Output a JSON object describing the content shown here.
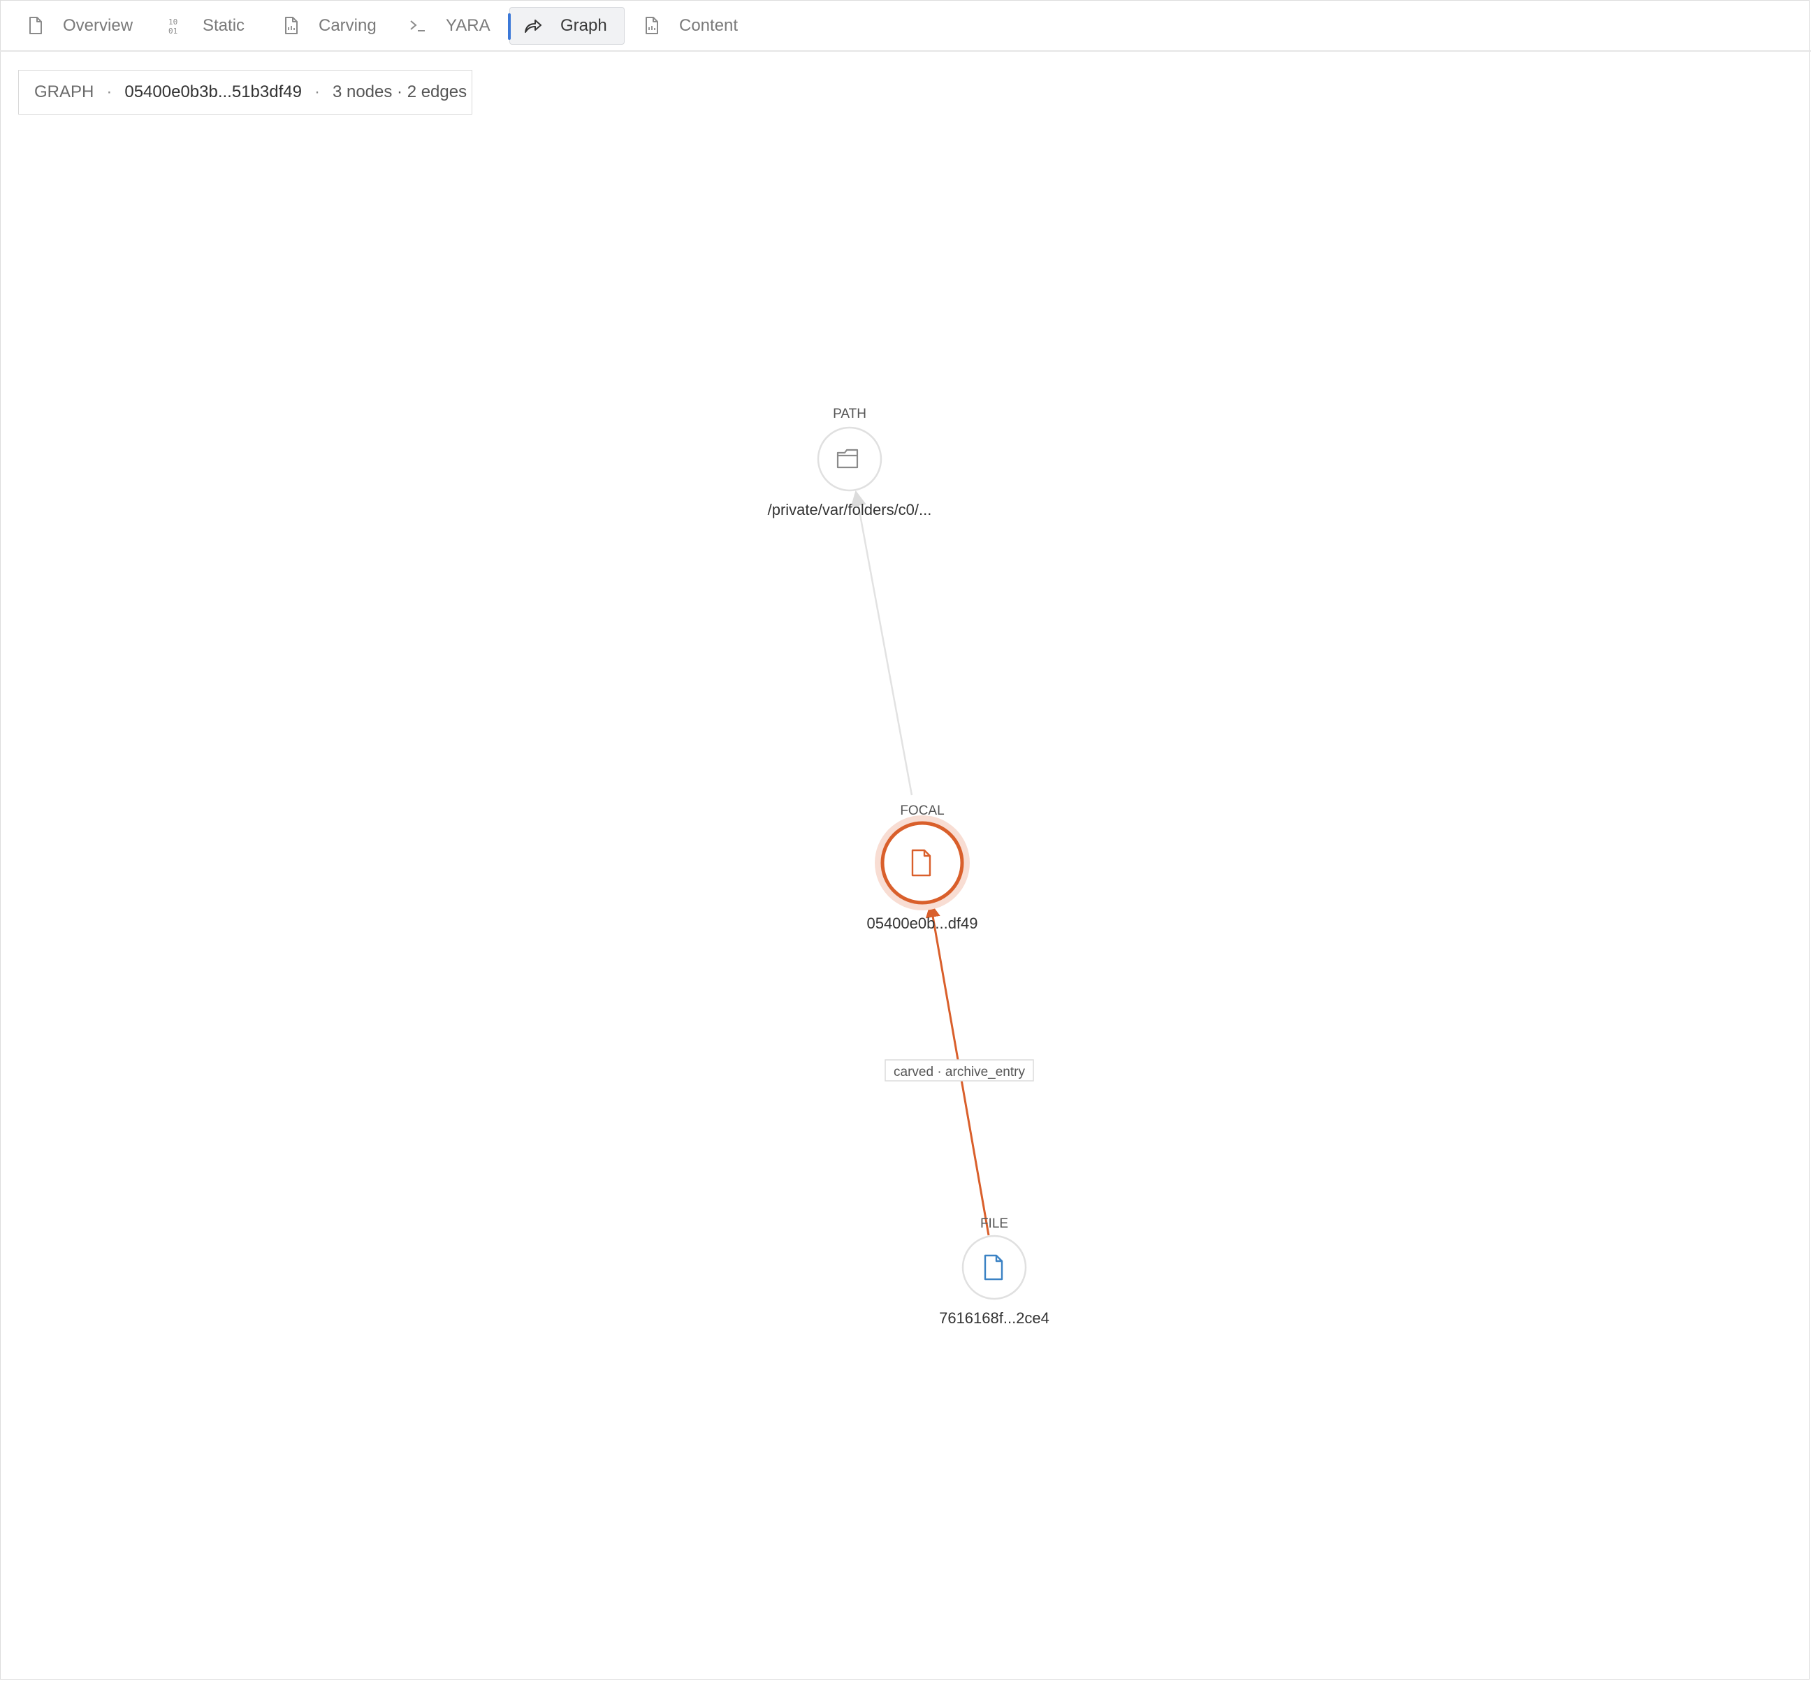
{
  "tabs": [
    {
      "label": "Overview",
      "icon": "file-icon"
    },
    {
      "label": "Static",
      "icon": "binary-icon"
    },
    {
      "label": "Carving",
      "icon": "file-chart-icon"
    },
    {
      "label": "YARA",
      "icon": "terminal-icon"
    },
    {
      "label": "Graph",
      "icon": "share-arrow-icon",
      "active": true
    },
    {
      "label": "Content",
      "icon": "file-chart-icon"
    }
  ],
  "info": {
    "prefix": "GRAPH",
    "sep": "·",
    "hash": "05400e0b3b...51b3df49",
    "counts": "3 nodes · 2 edges"
  },
  "graph": {
    "nodes": [
      {
        "id": "path",
        "type": "PATH",
        "label": "/private/var/folders/c0/...",
        "icon": "folder-icon"
      },
      {
        "id": "focal",
        "type": "FOCAL",
        "label": "05400e0b...df49",
        "icon": "file-icon"
      },
      {
        "id": "file",
        "type": "FILE",
        "label": "7616168f...2ce4",
        "icon": "file-icon"
      }
    ],
    "edges": [
      {
        "from": "focal",
        "to": "path",
        "label": ""
      },
      {
        "from": "file",
        "to": "focal",
        "label": "carved · archive_entry"
      }
    ],
    "colors": {
      "focal": "#d95f2b",
      "focal_halo": "#f8ddd3",
      "file_icon": "#3b82c4",
      "path_icon": "#8a8a8a",
      "neutral_edge": "#e2e2e2",
      "accent": "#3b78d8"
    }
  }
}
